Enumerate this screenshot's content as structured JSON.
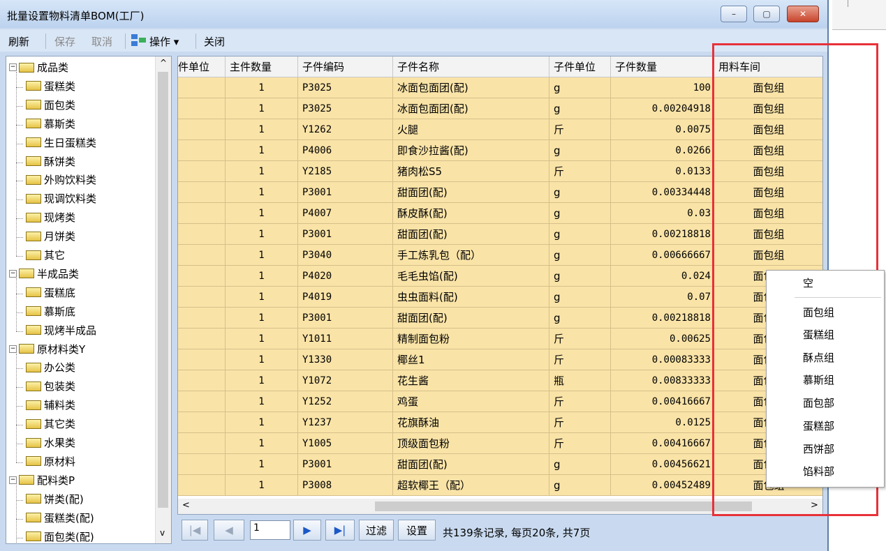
{
  "window": {
    "title": "批量设置物料清单BOM(工厂)",
    "min": "–",
    "max": "▢",
    "close": "✕"
  },
  "toolbar": {
    "refresh": "刷新",
    "save": "保存",
    "cancel": "取消",
    "operate": "操作 ▾",
    "close": "关闭"
  },
  "tree": [
    {
      "label": "成品类",
      "level": 0,
      "expanded": true
    },
    {
      "label": "蛋糕类",
      "level": 1
    },
    {
      "label": "面包类",
      "level": 1
    },
    {
      "label": "慕斯类",
      "level": 1
    },
    {
      "label": "生日蛋糕类",
      "level": 1
    },
    {
      "label": "酥饼类",
      "level": 1
    },
    {
      "label": "外购饮料类",
      "level": 1
    },
    {
      "label": "现调饮料类",
      "level": 1
    },
    {
      "label": "现烤类",
      "level": 1
    },
    {
      "label": "月饼类",
      "level": 1
    },
    {
      "label": "其它",
      "level": 1
    },
    {
      "label": "半成品类",
      "level": 0,
      "expanded": true
    },
    {
      "label": "蛋糕底",
      "level": 1
    },
    {
      "label": "慕斯底",
      "level": 1
    },
    {
      "label": "现烤半成品",
      "level": 1
    },
    {
      "label": "原材料类Y",
      "level": 0,
      "expanded": true
    },
    {
      "label": "办公类",
      "level": 1
    },
    {
      "label": "包装类",
      "level": 1
    },
    {
      "label": "辅料类",
      "level": 1
    },
    {
      "label": "其它类",
      "level": 1
    },
    {
      "label": "水果类",
      "level": 1
    },
    {
      "label": "原材料",
      "level": 1
    },
    {
      "label": "配料类P",
      "level": 0,
      "expanded": true
    },
    {
      "label": "饼类(配)",
      "level": 1
    },
    {
      "label": "蛋糕类(配)",
      "level": 1
    },
    {
      "label": "面包类(配)",
      "level": 1
    }
  ],
  "grid": {
    "headers": [
      "件单位",
      "主件数量",
      "子件编码",
      "子件名称",
      "子件单位",
      "子件数量",
      "用料车间"
    ],
    "rows": [
      [
        "",
        "1",
        "P3025",
        "冰面包面团(配)",
        "g",
        "100",
        "面包组"
      ],
      [
        "",
        "1",
        "P3025",
        "冰面包面团(配)",
        "g",
        "0.00204918",
        "面包组"
      ],
      [
        "",
        "1",
        "Y1262",
        "火腿",
        "斤",
        "0.0075",
        "面包组"
      ],
      [
        "",
        "1",
        "P4006",
        "即食沙拉酱(配)",
        "g",
        "0.0266",
        "面包组"
      ],
      [
        "",
        "1",
        "Y2185",
        "猪肉松S5",
        "斤",
        "0.0133",
        "面包组"
      ],
      [
        "",
        "1",
        "P3001",
        "甜面团(配)",
        "g",
        "0.00334448",
        "面包组"
      ],
      [
        "",
        "1",
        "P4007",
        "酥皮酥(配)",
        "g",
        "0.03",
        "面包组"
      ],
      [
        "",
        "1",
        "P3001",
        "甜面团(配)",
        "g",
        "0.00218818",
        "面包组"
      ],
      [
        "",
        "1",
        "P3040",
        "手工炼乳包（配）",
        "g",
        "0.00666667",
        "面包组"
      ],
      [
        "",
        "1",
        "P4020",
        "毛毛虫馅(配)",
        "g",
        "0.024",
        "面包组"
      ],
      [
        "",
        "1",
        "P4019",
        "虫虫面料(配)",
        "g",
        "0.07",
        "面包组"
      ],
      [
        "",
        "1",
        "P3001",
        "甜面团(配)",
        "g",
        "0.00218818",
        "面包组"
      ],
      [
        "",
        "1",
        "Y1011",
        "精制面包粉",
        "斤",
        "0.00625",
        "面包组"
      ],
      [
        "",
        "1",
        "Y1330",
        "椰丝1",
        "斤",
        "0.00083333",
        "面包组"
      ],
      [
        "",
        "1",
        "Y1072",
        "花生酱",
        "瓶",
        "0.00833333",
        "面包组"
      ],
      [
        "",
        "1",
        "Y1252",
        "鸡蛋",
        "斤",
        "0.00416667",
        "面包组"
      ],
      [
        "",
        "1",
        "Y1237",
        "花旗酥油",
        "斤",
        "0.0125",
        "面包组"
      ],
      [
        "",
        "1",
        "Y1005",
        "顶级面包粉",
        "斤",
        "0.00416667",
        "面包组"
      ],
      [
        "",
        "1",
        "P3001",
        "甜面团(配)",
        "g",
        "0.00456621",
        "面包组"
      ],
      [
        "",
        "1",
        "P3008",
        "超软椰王（配）",
        "g",
        "0.00452489",
        "面包组"
      ]
    ]
  },
  "pager": {
    "first": "|◀",
    "prev": "◀",
    "page": "1",
    "next": "▶",
    "last": "▶|",
    "filter": "过滤",
    "settings": "设置",
    "info": "共139条记录, 每页20条, 共7页"
  },
  "dropdown": {
    "items": [
      "空",
      "面包组",
      "蛋糕组",
      "酥点组",
      "慕斯组",
      "面包部",
      "蛋糕部",
      "西饼部",
      "馅料部"
    ]
  },
  "scroll": {
    "left": "<",
    "right": ">",
    "up": "^",
    "down": "v"
  }
}
